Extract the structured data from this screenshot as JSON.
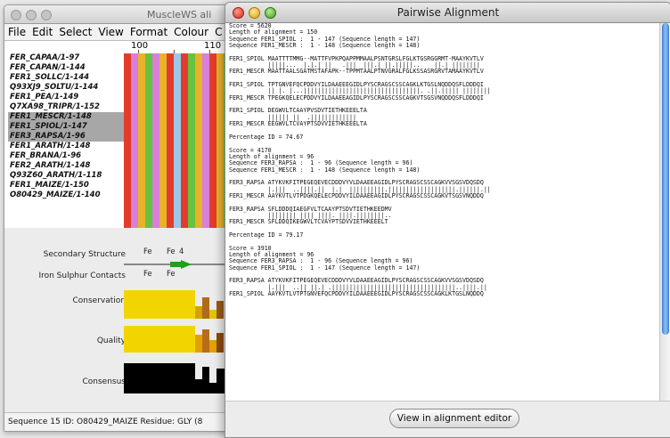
{
  "back_window": {
    "title": "MuscleWS ali",
    "menu": [
      "File",
      "Edit",
      "Select",
      "View",
      "Format",
      "Colour",
      "C"
    ],
    "ruler": [
      "100",
      "110"
    ],
    "sequences": [
      {
        "name": "FER_CAPAA/1-97",
        "selected": false
      },
      {
        "name": "FER_CAPAN/1-144",
        "selected": false
      },
      {
        "name": "FER1_SOLLC/1-144",
        "selected": false
      },
      {
        "name": "Q93XJ9_SOLTU/1-144",
        "selected": false
      },
      {
        "name": "FER1_PEA/1-149",
        "selected": false
      },
      {
        "name": "Q7XA98_TRIPR/1-152",
        "selected": false
      },
      {
        "name": "FER1_MESCR/1-148",
        "selected": true
      },
      {
        "name": "FER1_SPIOL/1-147",
        "selected": true
      },
      {
        "name": "FER3_RAPSA/1-96",
        "selected": true
      },
      {
        "name": "FER1_ARATH/1-148",
        "selected": false
      },
      {
        "name": "FER_BRANA/1-96",
        "selected": false
      },
      {
        "name": "FER2_ARATH/1-148",
        "selected": false
      },
      {
        "name": "Q93Z60_ARATH/1-118",
        "selected": false
      },
      {
        "name": "FER1_MAIZE/1-150",
        "selected": false
      },
      {
        "name": "O80429_MAIZE/1-140",
        "selected": false
      }
    ],
    "column_colors": [
      "#e33c2c",
      "#d97fd9",
      "#e8b32a",
      "#66c23f",
      "#d97fd9",
      "#e8b32a",
      "#e33c2c",
      "#9cc8e8",
      "#e33c2c",
      "#66c23f",
      "#e8b32a",
      "#d97fd9",
      "#e33c2c",
      "#e8b32a",
      "#66c23f",
      "#9cc8e8",
      "#d97fd9",
      "#e8b32a"
    ],
    "annotations": {
      "secondary_structure": "Secondary Structure",
      "iron_sulphur": "Iron Sulphur Contacts",
      "conservation": "Conservation",
      "quality": "Quality",
      "consensus": "Consensus",
      "fe_ss": [
        "Fe",
        "Fe",
        "4"
      ],
      "fe_is": [
        "Fe",
        "Fe"
      ]
    },
    "status": "Sequence 15 ID: O80429_MAIZE   Residue: GLY (8"
  },
  "front_window": {
    "title": "Pairwise Alignment",
    "button_label": "View in alignment editor",
    "text_lines": [
      "Score = 5620",
      "Length of alignment = 150",
      "Sequence FER1_SPIOL :  1 - 147 (Sequence length = 147)",
      "Sequence FER1_MESCR :  1 - 148 (Sequence length = 148)",
      "",
      "FER1_SPIOL MAATTTTMMG--MATTFVPKPQAPPMMAALPSNTGRSLFGLKTGSRGGRMT-MAAYKVTLV",
      "           |||||...  |.|.| ||   .|||  |||.| ||.|||||..    ||.| ||||||||",
      "FER1_MESCR MAATTAALSGATMSTAFAPK--TPPMTAALPTNVGRALFGLKSSASRGRVTAMAAYKVTLV",
      "",
      "FER1_SPIOL TPTGNVEFQCPDDVYILDAAEEEGIDLPYSCRAGSCSSCAGKLKTGSLNQDDQSFLDDDQI",
      "           || |. |...|||||||||||||||||||||||||||||||||. .||.||||| ||||||||",
      "FER1_MESCR TPEGKQELECPDDVYILDAAEEAGIDLPYSCRAGSCSSCAGKVTSGSVNQDDQSFLDDDQI",
      "",
      "FER1_SPIOL DEGWVLTCAAYPVSDVTIETHKEEELTA",
      "           |||||| ||  .|||||||||||||",
      "FER1_MESCR EEGWVLTCVAYPTSDVVIETHKEEELTA",
      "",
      "Percentage ID = 74.67",
      "",
      "Score = 4170",
      "Length of alignment = 96",
      "Sequence FER3_RAPSA :  1 - 96 (Sequence length = 96)",
      "Sequence FER1_MESCR :  1 - 148 (Sequence length = 148)",
      "",
      "FER3_RAPSA ATYKVKFITPEGEQEVECDDDVYVLDAAEEAGIDLPYSCRAGSCSSCAGKVVSGSVDQSDQ",
      "           |.|||  ..||||.||  |.|  ||||||||||.|||||||||||||||||||.||||||.||",
      "FER1_MESCR AAYKVTLVTPDGKQELECPDDVYILDAAEEAGIDLPYSCRAGSCSSCAGKVTSGSVNQDDQ",
      "",
      "FER3_RAPSA SFLDDDQIAEGFVLTCAAYPTSDVTIETHKEEDMV",
      "           |||||||| |||| ||||. ||||.||||||||..",
      "FER1_MESCR SFLDDQIKEGWVLTCVAYPTSDVVIETHKEEELT",
      "",
      "Percentage ID = 79.17",
      "",
      "Score = 3910",
      "Length of alignment = 96",
      "Sequence FER3_RAPSA :  1 - 96 (Sequence length = 96)",
      "Sequence FER1_SPIOL :  1 - 147 (Sequence length = 147)",
      "",
      "FER3_RAPSA ATYKVKFITPEGEQEVECDDDVYVLDAAEEAGIDLPYSCRAGSCSSCAGKVVSGSVDQSDQ",
      "           |.|||  ..|| ||.| .|||||||||||||||||||||||||||||||||||..||||.||",
      "FER1_SPIOL AAYKVTLVTPTGNVEFQCPDDVYILDAAEEEGIDLPYSCRAGSCSSCAGKLKTGSLNQDDQ"
    ]
  }
}
